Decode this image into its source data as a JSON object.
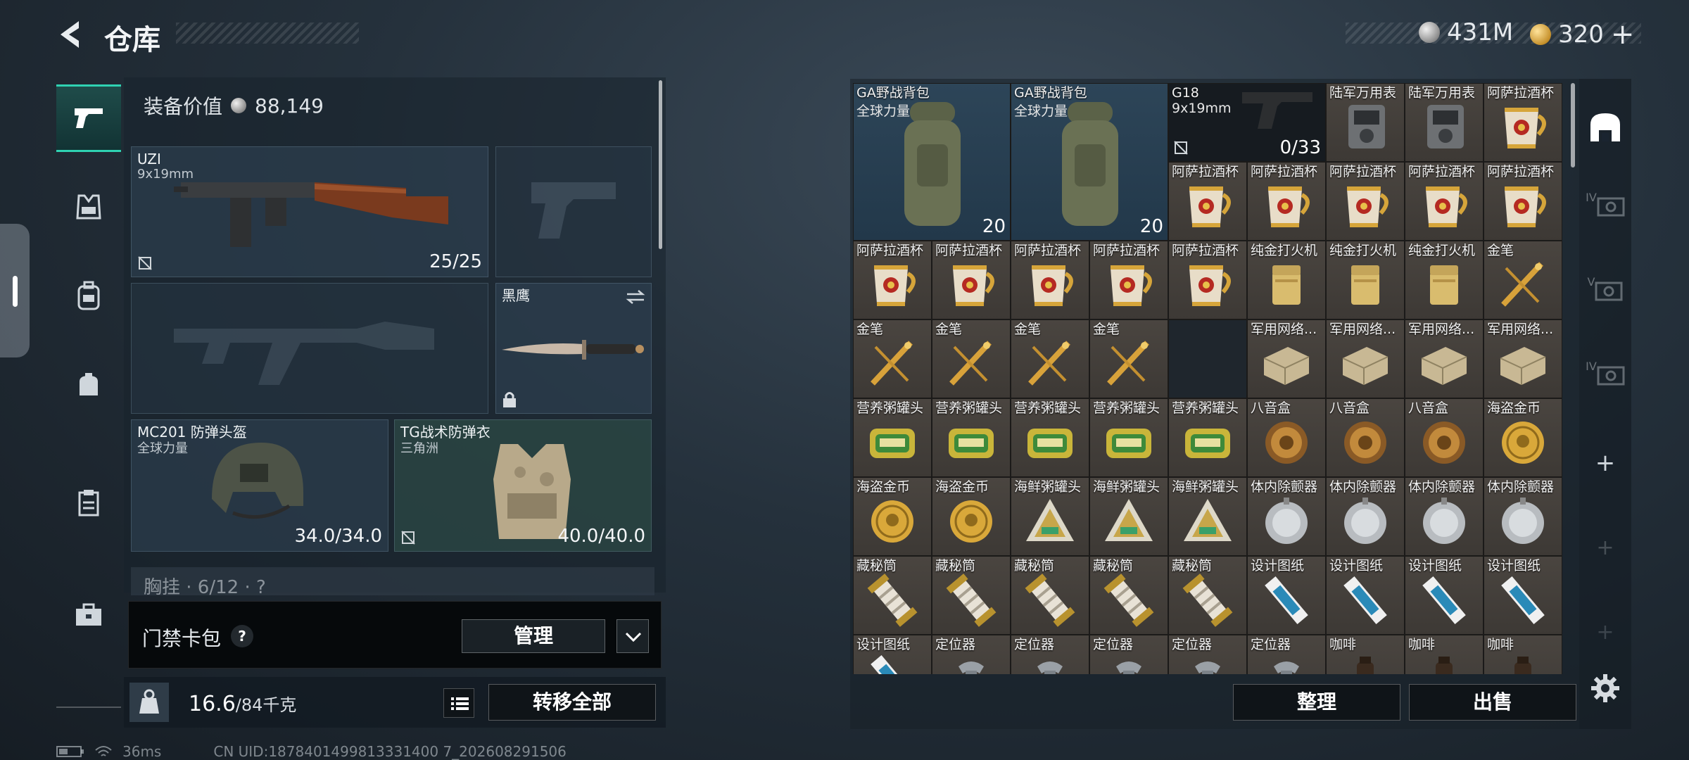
{
  "header": {
    "title": "仓库",
    "silver_amount": "431M",
    "gold_amount": "320",
    "gold_plus": "+"
  },
  "equipment": {
    "value_label": "装备价值",
    "value": "88,149",
    "primary_weapon": {
      "name": "UZI",
      "caliber": "9x19mm",
      "ammo": "25/25"
    },
    "melee": {
      "name": "黑鹰"
    },
    "helmet": {
      "name": "MC201 防弹头盔",
      "source": "全球力量",
      "durability": "34.0/34.0"
    },
    "armor": {
      "name": "TG战术防弹衣",
      "source": "三角洲",
      "durability": "40.0/40.0"
    },
    "chest_rig": "胸挂 · 6/12 · ?"
  },
  "keycard": {
    "label": "门禁卡包",
    "help": "?",
    "manage": "管理"
  },
  "weight": {
    "current": "16.6",
    "max": "/84千克",
    "transfer_all": "转移全部"
  },
  "status": {
    "ping": "36ms",
    "uid": "CN UID:1878401499813331400 7_202608291506"
  },
  "storage": {
    "backpacks": [
      {
        "name": "GA野战背包",
        "source": "全球力量",
        "count": "20"
      },
      {
        "name": "GA野战背包",
        "source": "全球力量",
        "count": "20"
      }
    ],
    "pistol": {
      "name": "G18",
      "caliber": "9x19mm",
      "ammo": "0/33"
    },
    "items": [
      "陆军万用表",
      "陆军万用表",
      "阿萨拉酒杯",
      "阿萨拉酒杯",
      "阿萨拉酒杯",
      "阿萨拉酒杯",
      "阿萨拉酒杯",
      "阿萨拉酒杯",
      "阿萨拉酒杯",
      "阿萨拉酒杯",
      "阿萨拉酒杯",
      "阿萨拉酒杯",
      "阿萨拉酒杯",
      "纯金打火机",
      "纯金打火机",
      "纯金打火机",
      "金笔",
      "金笔",
      "金笔",
      "金笔",
      "金笔",
      "",
      "军用网络...",
      "军用网络...",
      "军用网络...",
      "军用网络...",
      "营养粥罐头",
      "营养粥罐头",
      "营养粥罐头",
      "营养粥罐头",
      "营养粥罐头",
      "八音盒",
      "八音盒",
      "八音盒",
      "海盗金币",
      "海盗金币",
      "海盗金币",
      "海鲜粥罐头",
      "海鲜粥罐头",
      "海鲜粥罐头",
      "体内除颤器",
      "体内除颤器",
      "体内除颤器",
      "体内除颤器",
      "藏秘筒",
      "藏秘筒",
      "藏秘筒",
      "藏秘筒",
      "藏秘筒",
      "设计图纸",
      "设计图纸",
      "设计图纸",
      "设计图纸",
      "设计图纸",
      "定位器",
      "定位器",
      "定位器",
      "定位器",
      "定位器",
      "咖啡",
      "咖啡",
      "咖啡"
    ],
    "sort": "整理",
    "sell": "出售"
  },
  "rail": {
    "tab2": "IV",
    "tab3": "V",
    "tab4": "IV",
    "add": "+"
  },
  "colors": {
    "accent": "#2fd2b2",
    "gold": "#d8a23a"
  }
}
